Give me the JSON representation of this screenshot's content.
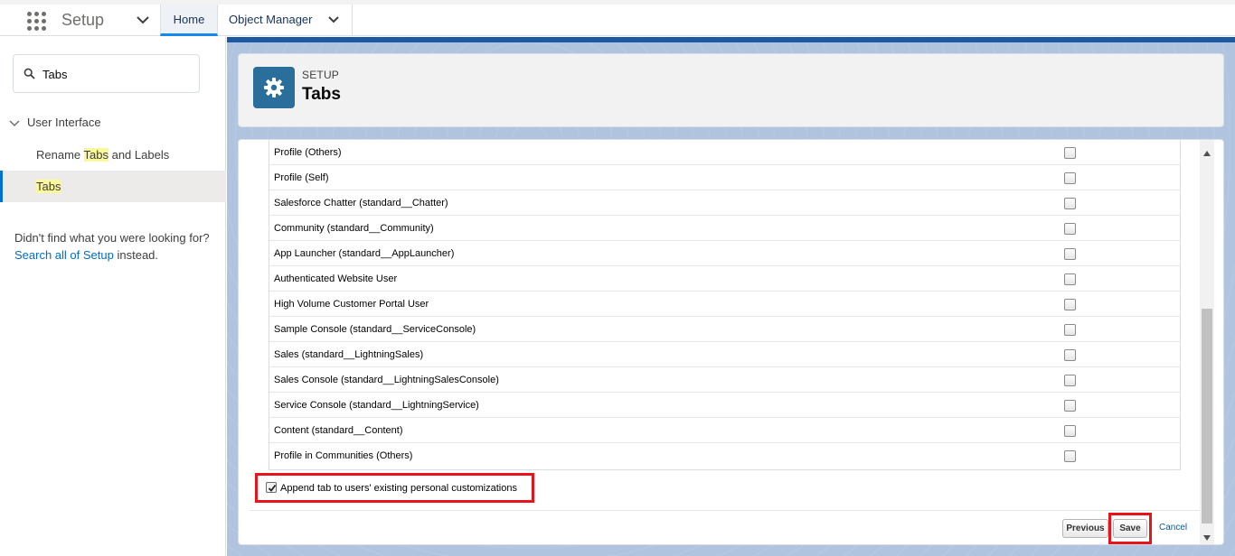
{
  "topbar": {
    "app_name": "Setup",
    "tabs": [
      {
        "label": "Home"
      },
      {
        "label": "Object Manager"
      }
    ]
  },
  "sidebar": {
    "quickfind_value": "Tabs",
    "tree_parent": "User Interface",
    "items": [
      {
        "pre": "Rename ",
        "hl": "Tabs",
        "post": " and Labels"
      },
      {
        "pre": "",
        "hl": "Tabs",
        "post": ""
      }
    ],
    "notfound_text": "Didn't find what you were looking for?",
    "notfound_link": "Search all of Setup",
    "notfound_suffix": "instead."
  },
  "header": {
    "eyebrow": "SETUP",
    "title": "Tabs"
  },
  "tab_rows": [
    {
      "label": "Profile (Others)",
      "checked": false
    },
    {
      "label": "Profile (Self)",
      "checked": false
    },
    {
      "label": "Salesforce Chatter (standard__Chatter)",
      "checked": false
    },
    {
      "label": "Community (standard__Community)",
      "checked": false
    },
    {
      "label": "App Launcher (standard__AppLauncher)",
      "checked": false
    },
    {
      "label": "Authenticated Website User",
      "checked": false
    },
    {
      "label": "High Volume Customer Portal User",
      "checked": false
    },
    {
      "label": "Sample Console (standard__ServiceConsole)",
      "checked": false
    },
    {
      "label": "Sales (standard__LightningSales)",
      "checked": false
    },
    {
      "label": "Sales Console (standard__LightningSalesConsole)",
      "checked": false
    },
    {
      "label": "Service Console (standard__LightningService)",
      "checked": false
    },
    {
      "label": "Content (standard__Content)",
      "checked": false
    },
    {
      "label": "Profile in Communities (Others)",
      "checked": false
    }
  ],
  "append": {
    "label": "Append tab to users' existing personal customizations",
    "checked": true
  },
  "buttons": {
    "previous": "Previous",
    "save": "Save",
    "cancel": "Cancel"
  },
  "colors": {
    "highlight_box": "#e8141c",
    "brand_blue": "#2a6f9b",
    "link": "#006dcc"
  }
}
